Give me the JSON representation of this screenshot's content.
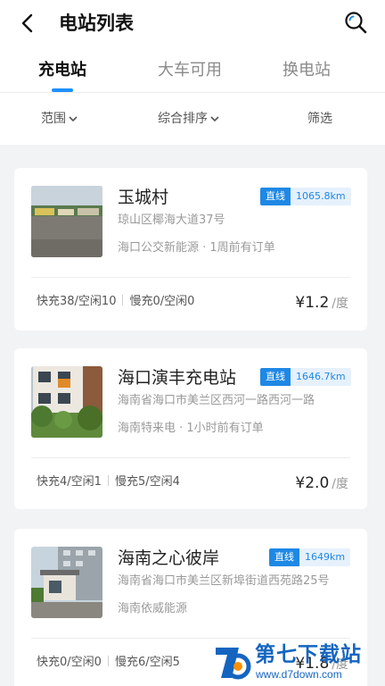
{
  "header": {
    "title": "电站列表",
    "back_icon": "chevron-left-icon",
    "search_icon": "search-icon"
  },
  "tabs": [
    {
      "label": "充电站",
      "active": true
    },
    {
      "label": "大车可用",
      "active": false
    },
    {
      "label": "换电站",
      "active": false
    }
  ],
  "filters": [
    {
      "label": "范围",
      "has_dropdown": true
    },
    {
      "label": "综合排序",
      "has_dropdown": true
    },
    {
      "label": "筛选",
      "has_dropdown": false
    }
  ],
  "colors": {
    "accent": "#1e88e5",
    "accent_light": "#e6f1fc",
    "page_bg": "#f2f3f5"
  },
  "stations": [
    {
      "name": "玉城村",
      "tag": "直线",
      "distance": "1065.8km",
      "address": "琼山区椰海大道37号",
      "operator": "海口公交新能源 · 1周前有订单",
      "fast": "快充38/空闲10",
      "slow": "慢充0/空闲0",
      "price": "¥1.2",
      "unit": "/度"
    },
    {
      "name": "海口演丰充电站",
      "tag": "直线",
      "distance": "1646.7km",
      "address": "海南省海口市美兰区西河一路西河一路",
      "operator": "海南特来电 · 1小时前有订单",
      "fast": "快充4/空闲1",
      "slow": "慢充5/空闲4",
      "price": "¥2.0",
      "unit": "/度"
    },
    {
      "name": "海南之心彼岸",
      "tag": "直线",
      "distance": "1649km",
      "address": "海南省海口市美兰区新埠街道西苑路25号",
      "operator": "海南依威能源",
      "fast": "快充0/空闲0",
      "slow": "慢充6/空闲5",
      "price": "¥1.8",
      "unit": "/度"
    }
  ],
  "watermark": {
    "title": "第七下载站",
    "url": "www.d7down.com"
  }
}
